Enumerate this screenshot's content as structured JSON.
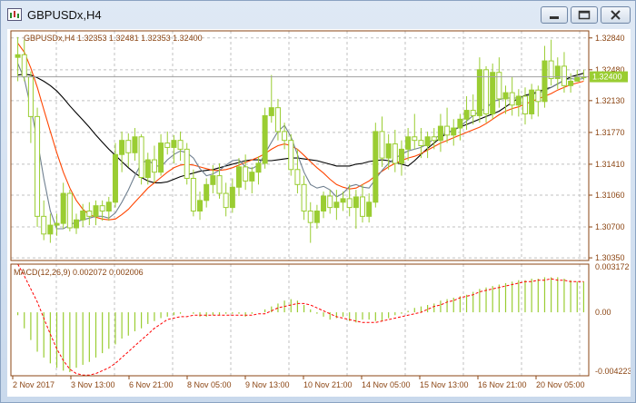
{
  "window": {
    "title": "GBPUSDx,H4"
  },
  "chart_data": {
    "type": "candlestick",
    "title": "GBPUSDx,H4",
    "symbol": "GBPUSDx",
    "timeframe": "H4",
    "ohlc_header": {
      "label": "GBPUSDx,H4",
      "values": [
        "1.32353",
        "1.32481",
        "1.32353",
        "1.32400"
      ]
    },
    "current_price": "1.32400",
    "price_axis_ticks": [
      "1.32840",
      "1.32480",
      "1.32130",
      "1.31770",
      "1.31410",
      "1.31060",
      "1.30700",
      "1.30350"
    ],
    "ylim": [
      1.3032,
      1.3292
    ],
    "time_labels": [
      "2 Nov 2017",
      "3 Nov 13:00",
      "6 Nov 21:00",
      "8 Nov 05:00",
      "9 Nov 13:00",
      "10 Nov 21:00",
      "14 Nov 05:00",
      "15 Nov 13:00",
      "16 Nov 21:00",
      "20 Nov 05:00"
    ],
    "colors": {
      "bull": "#9acd32",
      "bear": "#9acd32",
      "ma_fast": "#708090",
      "ma_mid": "#ff4500",
      "ma_slow": "#000000",
      "grid": "#c0c0c0",
      "macd_hist": "#9acd32",
      "macd_signal": "#ff0000",
      "axis_text": "#8b4513"
    },
    "indicator": {
      "label": "MACD(12,26,9) 0.002072 0.002006",
      "axis_ticks": [
        "0.003172",
        "0.00",
        "-0.004223"
      ],
      "ylim": [
        -0.00435,
        0.0033
      ],
      "macd": [
        -0.0002,
        -0.0011,
        -0.0019,
        -0.0027,
        -0.0031,
        -0.0035,
        -0.0038,
        -0.004,
        -0.0041,
        -0.0038,
        -0.0036,
        -0.0034,
        -0.0031,
        -0.0028,
        -0.0025,
        -0.0022,
        -0.0018,
        -0.0016,
        -0.0013,
        -0.0011,
        -0.0008,
        -0.0006,
        -0.0004,
        -0.0003,
        -0.0002,
        -0.0001,
        0,
        -0.0001,
        -0.0003,
        -0.0003,
        -0.0002,
        -0.0002,
        -0.0001,
        -0.0001,
        -0.0001,
        -0.0003,
        -0.0001,
        0,
        0.0002,
        0.0004,
        0.0006,
        0.0008,
        0.0009,
        0.0008,
        0.0005,
        0.0002,
        -0.0001,
        -0.0003,
        -0.0005,
        -0.0004,
        -0.0003,
        -0.0006,
        -0.0007,
        -0.0005,
        -0.0005,
        -0.0006,
        -0.0006,
        -0.0004,
        -0.0002,
        -0.0001,
        0.0001,
        0.0003,
        0.0004,
        0.0005,
        0.0006,
        0.0008,
        0.0009,
        0.001,
        0.0011,
        0.0012,
        0.0014,
        0.0016,
        0.0017,
        0.0018,
        0.0019,
        0.002,
        0.0021,
        0.0022,
        0.0022,
        0.0023,
        0.0023,
        0.0024,
        0.0024,
        0.0024,
        0.0023,
        0.0022,
        0.0021,
        0.0021
      ],
      "signal": [
        0.0033,
        0.0025,
        0.0016,
        0.0007,
        -0.0004,
        -0.0015,
        -0.0025,
        -0.0033,
        -0.0039,
        -0.0042,
        -0.0043,
        -0.0043,
        -0.0042,
        -0.004,
        -0.0038,
        -0.0035,
        -0.0031,
        -0.0027,
        -0.0023,
        -0.0019,
        -0.0015,
        -0.0011,
        -0.0008,
        -0.0005,
        -0.0004,
        -0.0003,
        -0.0003,
        -0.0002,
        -0.0002,
        -0.0002,
        -0.0002,
        -0.0002,
        -0.0002,
        -0.0002,
        -0.0002,
        -0.0002,
        -0.0002,
        -0.0001,
        -0.0001,
        0.0001,
        0.0003,
        0.0004,
        0.0005,
        0.0006,
        0.0006,
        0.0005,
        0.0003,
        0.0001,
        -0.0001,
        -0.0003,
        -0.0004,
        -0.0005,
        -0.0006,
        -0.0007,
        -0.0007,
        -0.0007,
        -0.0006,
        -0.0005,
        -0.0004,
        -0.0003,
        -0.0002,
        -0.0001,
        0,
        0.0002,
        0.0004,
        0.0005,
        0.0007,
        0.0008,
        0.001,
        0.0011,
        0.0012,
        0.0014,
        0.0015,
        0.0016,
        0.0017,
        0.0018,
        0.0019,
        0.002,
        0.0021,
        0.0021,
        0.0022,
        0.0022,
        0.0023,
        0.0022,
        0.0022,
        0.0021,
        0.0021,
        0.0021
      ]
    },
    "ma_fast": [
      1.3255,
      1.3238,
      1.3205,
      1.3168,
      1.3125,
      1.3088,
      1.3068,
      1.3068,
      1.3072,
      1.3076,
      1.3078,
      1.308,
      1.3082,
      1.3082,
      1.308,
      1.3086,
      1.3098,
      1.3112,
      1.3128,
      1.3142,
      1.3146,
      1.314,
      1.3138,
      1.3146,
      1.3152,
      1.3156,
      1.3154,
      1.3148,
      1.3136,
      1.3128,
      1.313,
      1.3134,
      1.314,
      1.3145,
      1.3146,
      1.3138,
      1.3136,
      1.314,
      1.3153,
      1.3166,
      1.3178,
      1.3185,
      1.3172,
      1.3152,
      1.3132,
      1.3118,
      1.3114,
      1.3116,
      1.3112,
      1.3104,
      1.3108,
      1.3116,
      1.3118,
      1.3115,
      1.3114,
      1.3124,
      1.3134,
      1.3142,
      1.3148,
      1.3152,
      1.3156,
      1.3158,
      1.316,
      1.3164,
      1.317,
      1.3174,
      1.3176,
      1.318,
      1.3184,
      1.319,
      1.3196,
      1.3201,
      1.3204,
      1.3212,
      1.3214,
      1.3216,
      1.3216,
      1.3216,
      1.3218,
      1.322,
      1.3222,
      1.3224,
      1.3228,
      1.3232,
      1.3236,
      1.3238,
      1.3237,
      1.3238
    ],
    "ma_mid": [
      1.3278,
      1.3268,
      1.325,
      1.3228,
      1.3203,
      1.3178,
      1.3154,
      1.3132,
      1.3114,
      1.31,
      1.309,
      1.3084,
      1.3081,
      1.3079,
      1.3078,
      1.3079,
      1.3084,
      1.309,
      1.3098,
      1.3106,
      1.3114,
      1.312,
      1.3126,
      1.3132,
      1.3137,
      1.314,
      1.3141,
      1.314,
      1.3138,
      1.3136,
      1.3134,
      1.3134,
      1.3135,
      1.3137,
      1.314,
      1.3143,
      1.3146,
      1.3149,
      1.3153,
      1.3158,
      1.3162,
      1.3164,
      1.3162,
      1.3158,
      1.3151,
      1.3144,
      1.3137,
      1.3131,
      1.3124,
      1.3118,
      1.3115,
      1.3113,
      1.3114,
      1.3118,
      1.3122,
      1.3128,
      1.3133,
      1.3138,
      1.3142,
      1.3145,
      1.3148,
      1.315,
      1.3153,
      1.3157,
      1.3161,
      1.3165,
      1.3168,
      1.3171,
      1.3174,
      1.3177,
      1.318,
      1.3183,
      1.3187,
      1.3192,
      1.3197,
      1.3201,
      1.3204,
      1.3206,
      1.3209,
      1.3212,
      1.3215,
      1.3218,
      1.3221,
      1.3225,
      1.3228,
      1.3231,
      1.3233,
      1.3235
    ],
    "ma_slow": [
      1.3242,
      1.3243,
      1.3242,
      1.3239,
      1.3235,
      1.323,
      1.3224,
      1.3216,
      1.3207,
      1.3199,
      1.3191,
      1.3183,
      1.3174,
      1.3166,
      1.3158,
      1.3151,
      1.3144,
      1.3137,
      1.3131,
      1.3126,
      1.3122,
      1.312,
      1.312,
      1.3121,
      1.3124,
      1.3127,
      1.3129,
      1.3131,
      1.3133,
      1.3134,
      1.3135,
      1.3137,
      1.3139,
      1.3141,
      1.3143,
      1.3145,
      1.3146,
      1.3146,
      1.3145,
      1.3145,
      1.3146,
      1.3147,
      1.3148,
      1.3148,
      1.3147,
      1.3146,
      1.3145,
      1.3143,
      1.3141,
      1.3139,
      1.3139,
      1.3139,
      1.3141,
      1.3142,
      1.3144,
      1.3145,
      1.3146,
      1.3145,
      1.3143,
      1.3141,
      1.3139,
      1.3145,
      1.3152,
      1.3159,
      1.3165,
      1.3171,
      1.3176,
      1.318,
      1.3183,
      1.3186,
      1.3189,
      1.3192,
      1.3195,
      1.3198,
      1.3201,
      1.3206,
      1.3211,
      1.3216,
      1.3219,
      1.3221,
      1.3223,
      1.3226,
      1.3228,
      1.3232,
      1.3236,
      1.324,
      1.3242,
      1.3244
    ],
    "candles": [
      [
        1.3262,
        1.3285,
        1.3235,
        1.3265
      ],
      [
        1.3265,
        1.3282,
        1.3235,
        1.324
      ],
      [
        1.324,
        1.3246,
        1.3165,
        1.3195
      ],
      [
        1.3195,
        1.3205,
        1.307,
        1.3082
      ],
      [
        1.3082,
        1.31,
        1.3055,
        1.3062
      ],
      [
        1.3062,
        1.3085,
        1.3052,
        1.3072
      ],
      [
        1.3072,
        1.3085,
        1.306,
        1.3074
      ],
      [
        1.3074,
        1.312,
        1.3068,
        1.3108
      ],
      [
        1.3108,
        1.3112,
        1.3065,
        1.3069
      ],
      [
        1.3069,
        1.3085,
        1.3062,
        1.3078
      ],
      [
        1.3078,
        1.3096,
        1.307,
        1.3088
      ],
      [
        1.3088,
        1.3098,
        1.3072,
        1.3082
      ],
      [
        1.3082,
        1.31,
        1.3072,
        1.3094
      ],
      [
        1.3094,
        1.31,
        1.3077,
        1.3088
      ],
      [
        1.3088,
        1.3104,
        1.3077,
        1.3098
      ],
      [
        1.3098,
        1.3165,
        1.3092,
        1.3152
      ],
      [
        1.3152,
        1.3178,
        1.3132,
        1.3168
      ],
      [
        1.3168,
        1.3176,
        1.3138,
        1.3154
      ],
      [
        1.3154,
        1.3182,
        1.3145,
        1.3172
      ],
      [
        1.3172,
        1.3175,
        1.3118,
        1.3126
      ],
      [
        1.3126,
        1.3154,
        1.3118,
        1.3146
      ],
      [
        1.3146,
        1.3162,
        1.312,
        1.3132
      ],
      [
        1.3132,
        1.3175,
        1.3128,
        1.3165
      ],
      [
        1.3165,
        1.3178,
        1.3152,
        1.316
      ],
      [
        1.316,
        1.3174,
        1.3142,
        1.3168
      ],
      [
        1.3168,
        1.3178,
        1.3145,
        1.3158
      ],
      [
        1.3158,
        1.3165,
        1.3118,
        1.3125
      ],
      [
        1.3125,
        1.3135,
        1.3082,
        1.3088
      ],
      [
        1.3088,
        1.311,
        1.3078,
        1.31
      ],
      [
        1.31,
        1.3125,
        1.3092,
        1.3118
      ],
      [
        1.3118,
        1.314,
        1.3108,
        1.3128
      ],
      [
        1.3128,
        1.3142,
        1.3102,
        1.3108
      ],
      [
        1.3108,
        1.312,
        1.3082,
        1.3092
      ],
      [
        1.3092,
        1.3125,
        1.3086,
        1.3115
      ],
      [
        1.3115,
        1.3148,
        1.3105,
        1.3138
      ],
      [
        1.3138,
        1.3152,
        1.3112,
        1.3122
      ],
      [
        1.3122,
        1.3138,
        1.3108,
        1.3132
      ],
      [
        1.3132,
        1.315,
        1.3118,
        1.3142
      ],
      [
        1.3142,
        1.3205,
        1.3136,
        1.3196
      ],
      [
        1.3196,
        1.3242,
        1.3188,
        1.3205
      ],
      [
        1.3205,
        1.3215,
        1.3168,
        1.3178
      ],
      [
        1.3178,
        1.3188,
        1.3158,
        1.3168
      ],
      [
        1.3168,
        1.3175,
        1.3128,
        1.3135
      ],
      [
        1.3135,
        1.3158,
        1.3108,
        1.3118
      ],
      [
        1.3118,
        1.3128,
        1.3078,
        1.3088
      ],
      [
        1.3088,
        1.3098,
        1.3052,
        1.3075
      ],
      [
        1.3075,
        1.3095,
        1.3068,
        1.3088
      ],
      [
        1.3088,
        1.311,
        1.308,
        1.3105
      ],
      [
        1.3105,
        1.3112,
        1.3085,
        1.3092
      ],
      [
        1.3092,
        1.3112,
        1.3078,
        1.3098
      ],
      [
        1.3098,
        1.311,
        1.3088,
        1.3102
      ],
      [
        1.3102,
        1.3118,
        1.3082,
        1.3092
      ],
      [
        1.3092,
        1.3112,
        1.3068,
        1.3104
      ],
      [
        1.3104,
        1.3118,
        1.3075,
        1.3082
      ],
      [
        1.3082,
        1.3108,
        1.3075,
        1.3098
      ],
      [
        1.3098,
        1.3188,
        1.3092,
        1.3178
      ],
      [
        1.3178,
        1.3195,
        1.3138,
        1.3148
      ],
      [
        1.3148,
        1.3175,
        1.3135,
        1.3164
      ],
      [
        1.3164,
        1.318,
        1.3132,
        1.3142
      ],
      [
        1.3142,
        1.3168,
        1.3128,
        1.3158
      ],
      [
        1.3158,
        1.3182,
        1.3145,
        1.3172
      ],
      [
        1.3172,
        1.3198,
        1.3158,
        1.3168
      ],
      [
        1.3168,
        1.3182,
        1.3148,
        1.3162
      ],
      [
        1.3162,
        1.3178,
        1.3148,
        1.3172
      ],
      [
        1.3172,
        1.3182,
        1.3158,
        1.3168
      ],
      [
        1.3168,
        1.3198,
        1.3155,
        1.3184
      ],
      [
        1.3184,
        1.3205,
        1.3165,
        1.3174
      ],
      [
        1.3174,
        1.3192,
        1.3162,
        1.3182
      ],
      [
        1.3182,
        1.3198,
        1.3168,
        1.3192
      ],
      [
        1.3192,
        1.3218,
        1.318,
        1.3202
      ],
      [
        1.3202,
        1.322,
        1.3186,
        1.3196
      ],
      [
        1.3196,
        1.3262,
        1.3188,
        1.3248
      ],
      [
        1.3248,
        1.3252,
        1.3188,
        1.3198
      ],
      [
        1.3198,
        1.3255,
        1.3192,
        1.3245
      ],
      [
        1.3245,
        1.3262,
        1.3205,
        1.3215
      ],
      [
        1.3215,
        1.323,
        1.3198,
        1.3222
      ],
      [
        1.3222,
        1.324,
        1.3196,
        1.3208
      ],
      [
        1.3208,
        1.3226,
        1.3195,
        1.3218
      ],
      [
        1.3218,
        1.3228,
        1.3186,
        1.3198
      ],
      [
        1.3198,
        1.3232,
        1.3192,
        1.3225
      ],
      [
        1.3225,
        1.323,
        1.3195,
        1.3212
      ],
      [
        1.3212,
        1.3275,
        1.3205,
        1.3258
      ],
      [
        1.3258,
        1.3282,
        1.323,
        1.3238
      ],
      [
        1.3238,
        1.3262,
        1.3226,
        1.3252
      ],
      [
        1.3252,
        1.3268,
        1.3222,
        1.323
      ],
      [
        1.323,
        1.3244,
        1.3222,
        1.3235
      ],
      [
        1.3235,
        1.3248,
        1.3235,
        1.324
      ],
      [
        1.324,
        1.3248,
        1.3236,
        1.324
      ]
    ]
  }
}
